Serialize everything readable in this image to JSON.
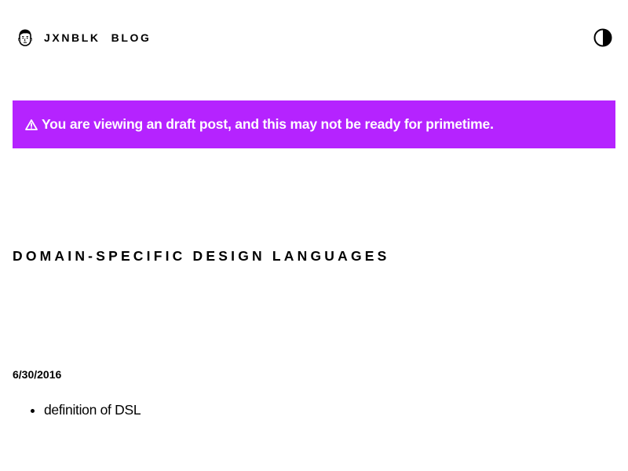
{
  "header": {
    "nav": [
      {
        "label": "JXNBLK"
      },
      {
        "label": "BLOG"
      }
    ],
    "avatar_icon": "face-avatar-icon",
    "theme_toggle_icon": "contrast-half-circle-icon"
  },
  "banner": {
    "icon": "warning-triangle-icon",
    "text": "You are viewing an draft post, and this may not be ready for primetime.",
    "background_color": "#b523ff",
    "text_color": "#ffffff"
  },
  "post": {
    "title": "DOMAIN-SPECIFIC DESIGN LANGUAGES",
    "date": "6/30/2016",
    "items": [
      "definition of DSL"
    ]
  }
}
